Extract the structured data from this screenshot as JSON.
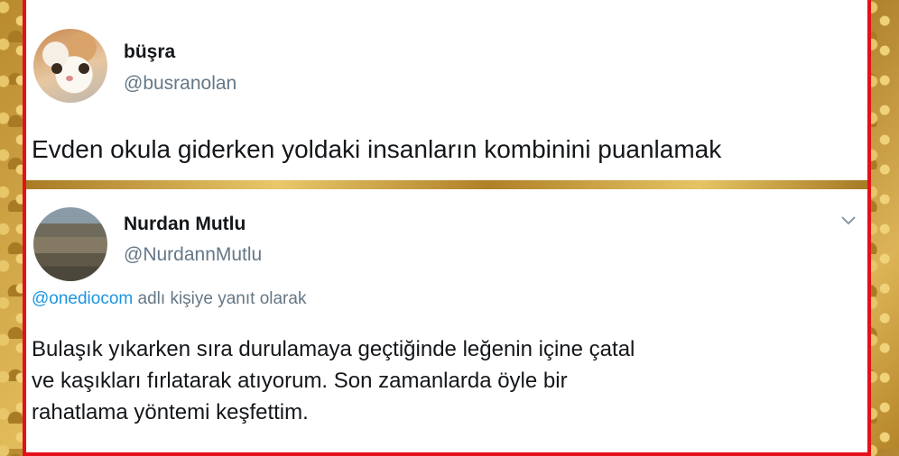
{
  "tweet1": {
    "name": "büşra",
    "handle": "@busranolan",
    "text": "Evden okula giderken yoldaki insanların kombinini puanlamak"
  },
  "tweet2": {
    "name": "Nurdan Mutlu",
    "handle": "@NurdannMutlu",
    "reply_mention": "@onediocom",
    "reply_rest": " adlı kişiye yanıt olarak",
    "text_lines": [
      "Bulaşık yıkarken sıra durulamaya geçtiğinde leğenin içine çatal",
      "ve kaşıkları fırlatarak atıyorum. Son zamanlarda öyle bir",
      "rahatlama yöntemi keşfettim."
    ]
  },
  "colors": {
    "frame_border": "#e4101a",
    "mention": "#1b95e0",
    "secondary_text": "#657786"
  }
}
